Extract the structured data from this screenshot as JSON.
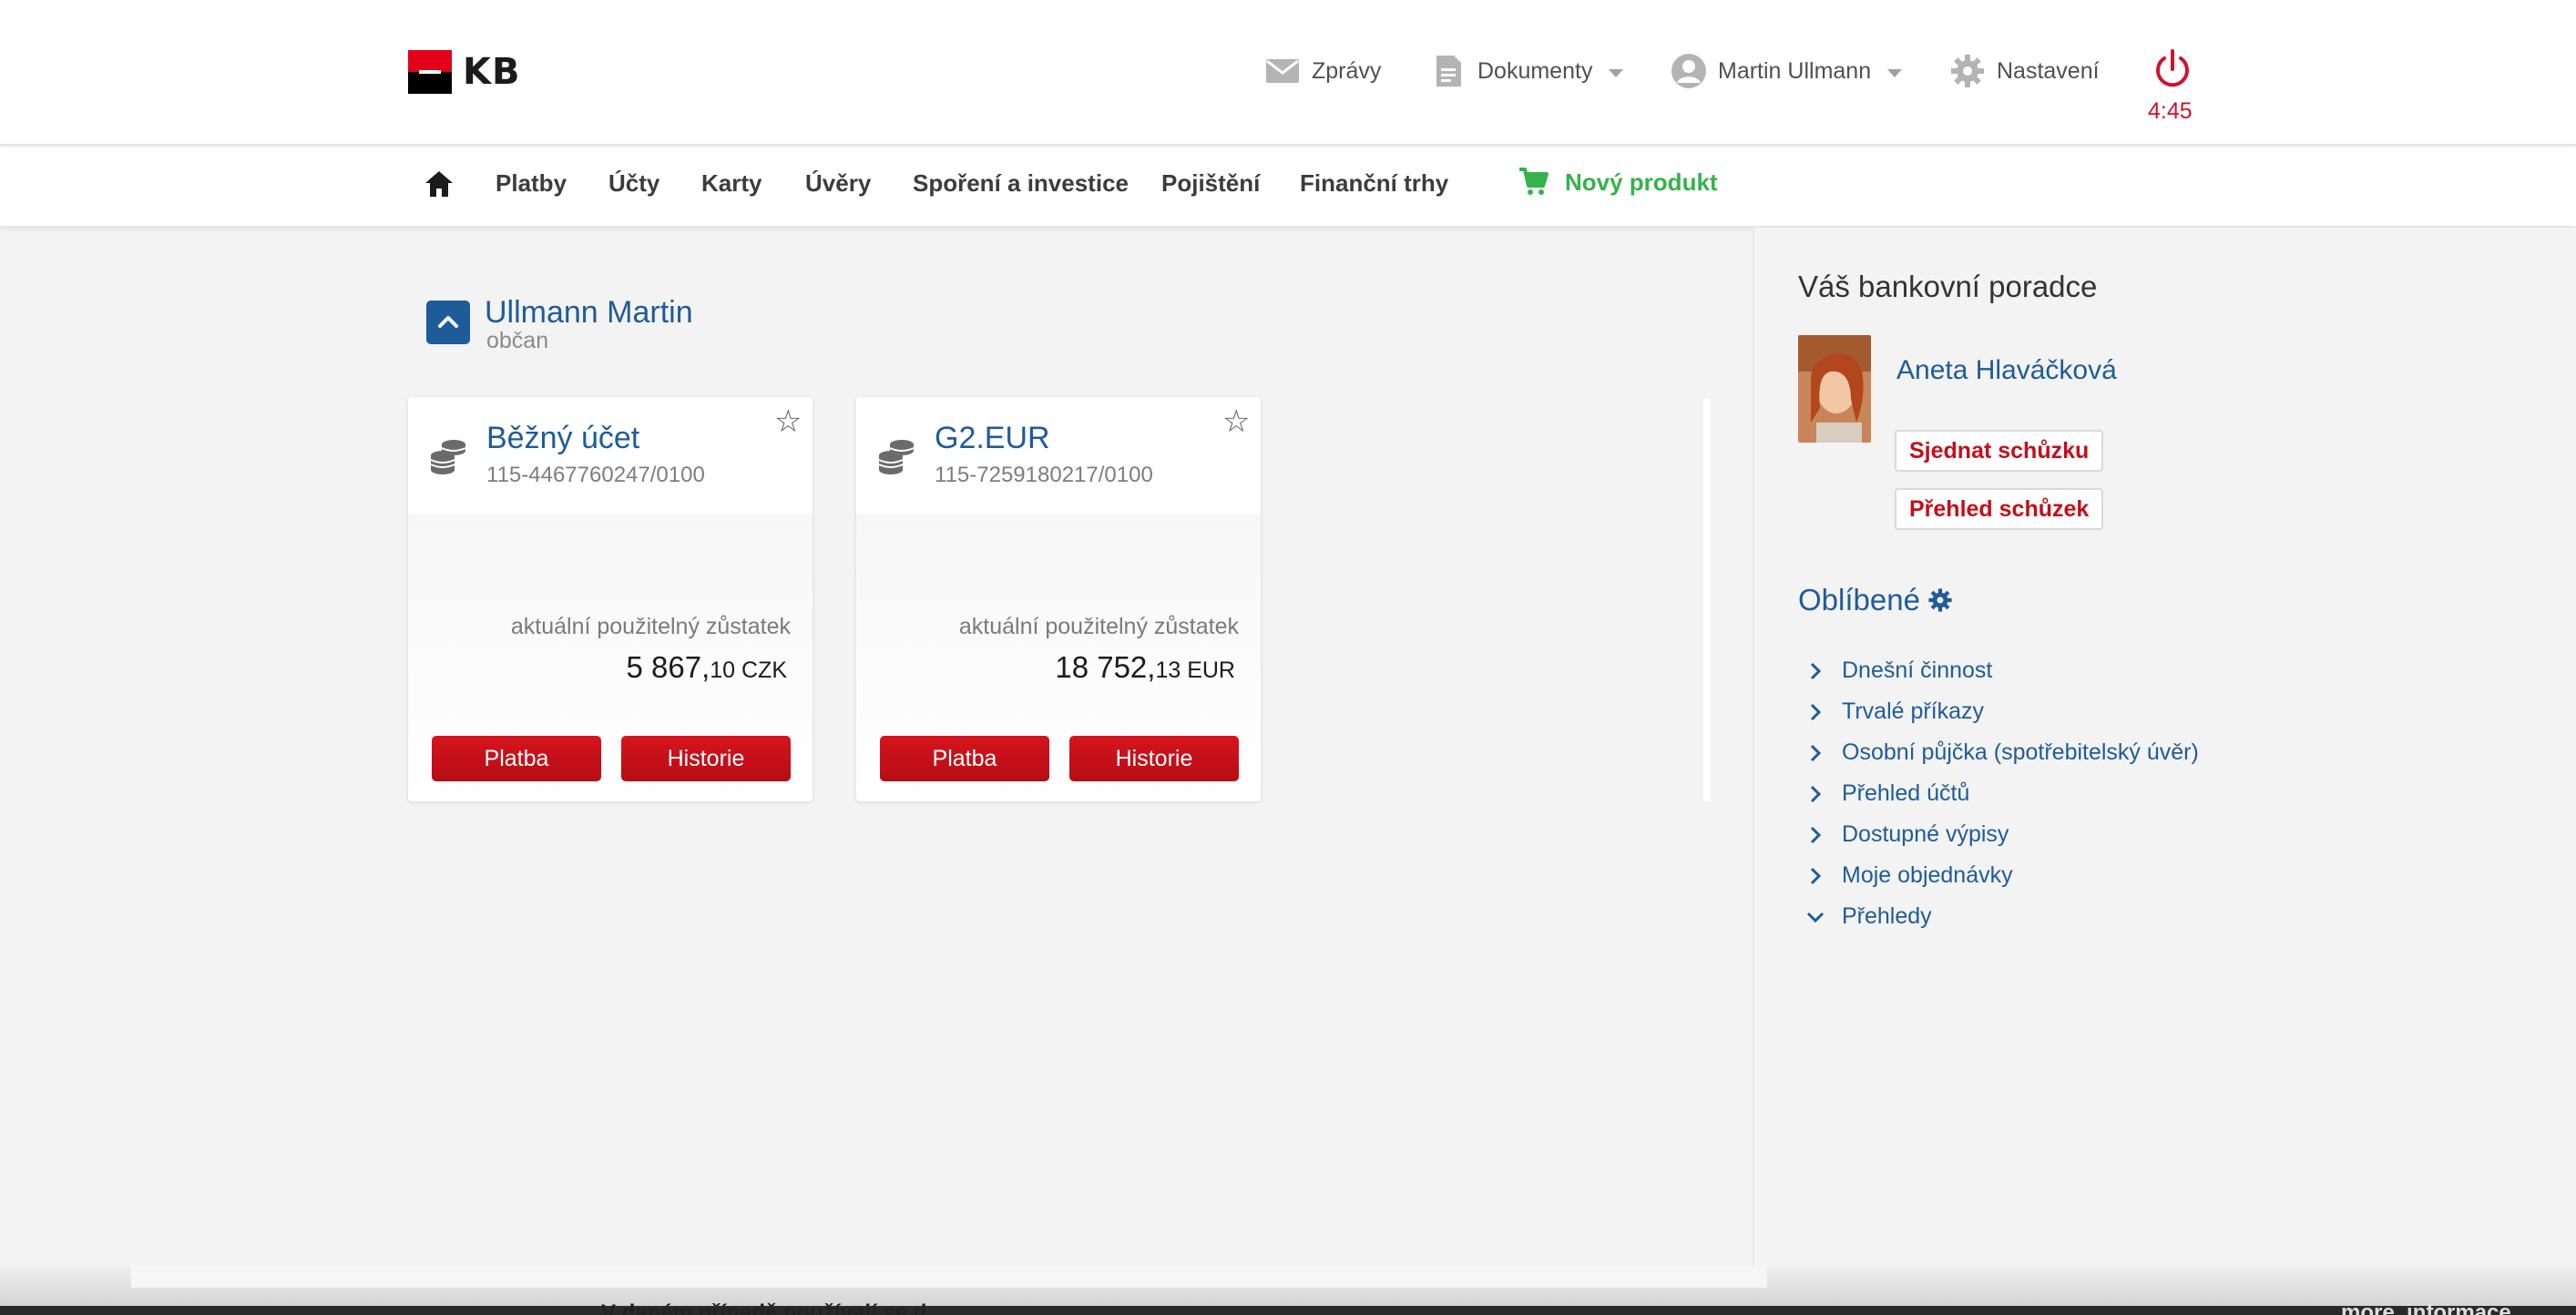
{
  "header": {
    "logo_text": "KB",
    "messages_label": "Zprávy",
    "documents_label": "Dokumenty",
    "user_label": "Martin Ullmann",
    "settings_label": "Nastavení",
    "session_timer": "4:45"
  },
  "nav": {
    "items": [
      "Platby",
      "Účty",
      "Karty",
      "Úvěry",
      "Spoření a investice",
      "Pojištění",
      "Finanční trhy"
    ],
    "new_product_label": "Nový produkt"
  },
  "client": {
    "name": "Ullmann Martin",
    "type": "občan"
  },
  "accounts": [
    {
      "title": "Běžný účet",
      "number": "115-4467760247/0100",
      "balance_label": "aktuální použitelný zůstatek",
      "balance_int": "5 867,",
      "balance_dec": "10 CZK",
      "pay_label": "Platba",
      "history_label": "Historie"
    },
    {
      "title": "G2.EUR",
      "number": "115-7259180217/0100",
      "balance_label": "aktuální použitelný zůstatek",
      "balance_int": "18 752,",
      "balance_dec": "13 EUR",
      "pay_label": "Platba",
      "history_label": "Historie"
    }
  ],
  "advisor": {
    "heading": "Váš bankovní poradce",
    "name": "Aneta Hlaváčková",
    "book_meeting_label": "Sjednat schůzku",
    "meetings_overview_label": "Přehled schůzek"
  },
  "favorites": {
    "heading": "Oblíbené",
    "items": [
      {
        "label": "Dnešní činnost",
        "expanded": false
      },
      {
        "label": "Trvalé příkazy",
        "expanded": false
      },
      {
        "label": "Osobní půjčka (spotřebitelský úvěr)",
        "expanded": false
      },
      {
        "label": "Přehled účtů",
        "expanded": false
      },
      {
        "label": "Dostupné výpisy",
        "expanded": false
      },
      {
        "label": "Moje objednávky",
        "expanded": false
      },
      {
        "label": "Přehledy",
        "expanded": true
      }
    ]
  },
  "footer_fragment": {
    "left_text": "V daném případě používají se d",
    "right_text": "more_informace"
  },
  "colors": {
    "brand_red": "#d4102e",
    "link_blue": "#1f5b99",
    "new_product_green": "#33b34a",
    "button_red": "#c40f1b"
  },
  "icons": {
    "messages": "envelope-icon",
    "documents": "document-icon",
    "user": "user-avatar-icon",
    "settings": "gear-icon",
    "logout": "power-icon",
    "home": "home-icon",
    "cart": "cart-icon",
    "coins": "coins-icon",
    "star": "star-icon"
  }
}
